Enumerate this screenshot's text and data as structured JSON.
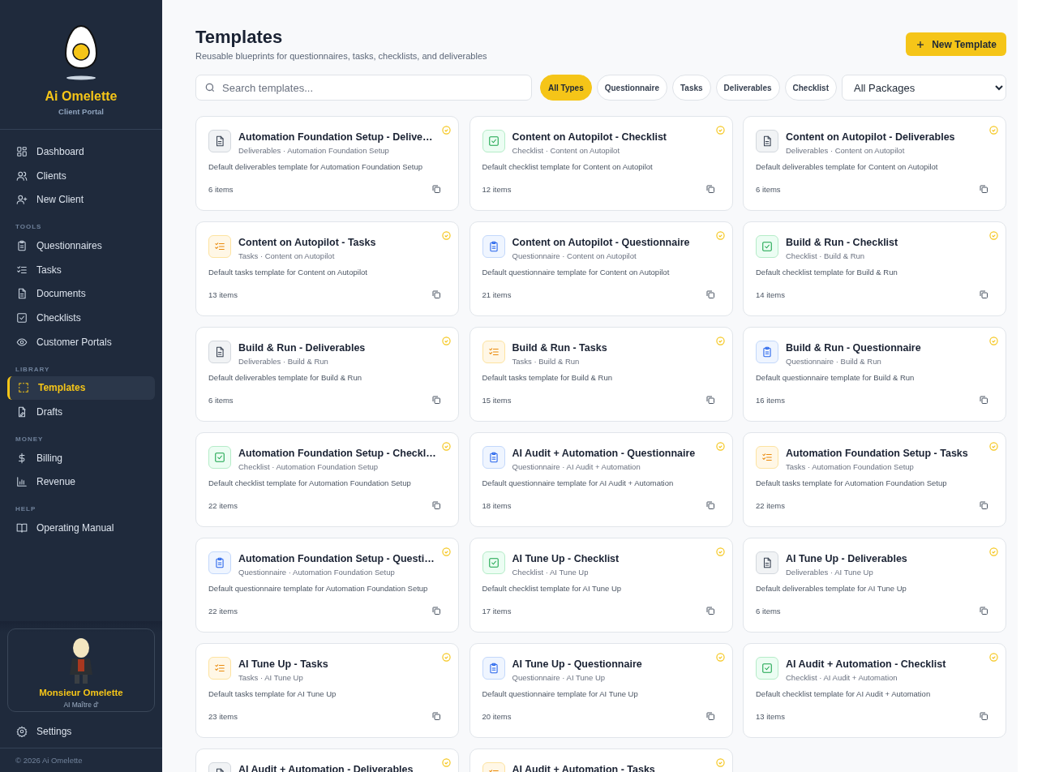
{
  "sidebar": {
    "brand": {
      "name": "Ai Omelette",
      "subtitle": "Client Portal"
    },
    "sections": [
      {
        "items": [
          {
            "label": "Dashboard",
            "selected": false
          },
          {
            "label": "Clients",
            "selected": false
          },
          {
            "label": "New Client",
            "selected": false
          }
        ]
      },
      {
        "label": "TOOLS",
        "items": [
          {
            "label": "Questionnaires",
            "selected": false
          },
          {
            "label": "Tasks",
            "selected": false
          },
          {
            "label": "Documents",
            "selected": false
          },
          {
            "label": "Checklists",
            "selected": false
          },
          {
            "label": "Customer Portals",
            "selected": false
          }
        ]
      },
      {
        "label": "LIBRARY",
        "items": [
          {
            "label": "Templates",
            "selected": true
          },
          {
            "label": "Drafts",
            "selected": false
          }
        ]
      },
      {
        "label": "MONEY",
        "items": [
          {
            "label": "Billing",
            "selected": false
          },
          {
            "label": "Revenue",
            "selected": false
          }
        ]
      },
      {
        "label": "HELP",
        "items": [
          {
            "label": "Operating Manual",
            "selected": false
          }
        ]
      }
    ],
    "profile": {
      "name": "Monsieur Omelette",
      "role": "AI Maître d'"
    },
    "settings": {
      "label": "Settings"
    },
    "footer": "© 2026 Ai Omelette"
  },
  "header": {
    "title": "Templates",
    "subtitle": "Reusable blueprints for questionnaires, tasks, checklists, and deliverables",
    "new_button": "New Template"
  },
  "filters": {
    "search_placeholder": "Search templates...",
    "chips": [
      {
        "label": "All Types",
        "selected": true
      },
      {
        "label": "Questionnaire",
        "selected": false
      },
      {
        "label": "Tasks",
        "selected": false
      },
      {
        "label": "Deliverables",
        "selected": false
      },
      {
        "label": "Checklist",
        "selected": false
      }
    ],
    "package_select": "All Packages"
  },
  "templates": [
    {
      "kind": "deliverables",
      "title": "Automation Foundation Setup - Delive…",
      "subtitle": "Deliverables · Automation Foundation Setup",
      "description": "Default deliverables template for Automation Foundation Setup",
      "count": "6 items"
    },
    {
      "kind": "checklist",
      "title": "Content on Autopilot - Checklist",
      "subtitle": "Checklist · Content on Autopilot",
      "description": "Default checklist template for Content on Autopilot",
      "count": "12 items"
    },
    {
      "kind": "deliverables",
      "title": "Content on Autopilot - Deliverables",
      "subtitle": "Deliverables · Content on Autopilot",
      "description": "Default deliverables template for Content on Autopilot",
      "count": "6 items"
    },
    {
      "kind": "tasks",
      "title": "Content on Autopilot - Tasks",
      "subtitle": "Tasks · Content on Autopilot",
      "description": "Default tasks template for Content on Autopilot",
      "count": "13 items"
    },
    {
      "kind": "questionnaire",
      "title": "Content on Autopilot - Questionnaire",
      "subtitle": "Questionnaire · Content on Autopilot",
      "description": "Default questionnaire template for Content on Autopilot",
      "count": "21 items"
    },
    {
      "kind": "checklist",
      "title": "Build & Run - Checklist",
      "subtitle": "Checklist · Build & Run",
      "description": "Default checklist template for Build & Run",
      "count": "14 items"
    },
    {
      "kind": "deliverables",
      "title": "Build & Run - Deliverables",
      "subtitle": "Deliverables · Build & Run",
      "description": "Default deliverables template for Build & Run",
      "count": "6 items"
    },
    {
      "kind": "tasks",
      "title": "Build & Run - Tasks",
      "subtitle": "Tasks · Build & Run",
      "description": "Default tasks template for Build & Run",
      "count": "15 items"
    },
    {
      "kind": "questionnaire",
      "title": "Build & Run - Questionnaire",
      "subtitle": "Questionnaire · Build & Run",
      "description": "Default questionnaire template for Build & Run",
      "count": "16 items"
    },
    {
      "kind": "checklist",
      "title": "Automation Foundation Setup - Checkl…",
      "subtitle": "Checklist · Automation Foundation Setup",
      "description": "Default checklist template for Automation Foundation Setup",
      "count": "22 items"
    },
    {
      "kind": "questionnaire",
      "title": "AI Audit + Automation - Questionnaire",
      "subtitle": "Questionnaire · AI Audit + Automation",
      "description": "Default questionnaire template for AI Audit + Automation",
      "count": "18 items"
    },
    {
      "kind": "tasks",
      "title": "Automation Foundation Setup - Tasks",
      "subtitle": "Tasks · Automation Foundation Setup",
      "description": "Default tasks template for Automation Foundation Setup",
      "count": "22 items"
    },
    {
      "kind": "questionnaire",
      "title": "Automation Foundation Setup - Questi…",
      "subtitle": "Questionnaire · Automation Foundation Setup",
      "description": "Default questionnaire template for Automation Foundation Setup",
      "count": "22 items"
    },
    {
      "kind": "checklist",
      "title": "AI Tune Up - Checklist",
      "subtitle": "Checklist · AI Tune Up",
      "description": "Default checklist template for AI Tune Up",
      "count": "17 items"
    },
    {
      "kind": "deliverables",
      "title": "AI Tune Up - Deliverables",
      "subtitle": "Deliverables · AI Tune Up",
      "description": "Default deliverables template for AI Tune Up",
      "count": "6 items"
    },
    {
      "kind": "tasks",
      "title": "AI Tune Up - Tasks",
      "subtitle": "Tasks · AI Tune Up",
      "description": "Default tasks template for AI Tune Up",
      "count": "23 items"
    },
    {
      "kind": "questionnaire",
      "title": "AI Tune Up - Questionnaire",
      "subtitle": "Questionnaire · AI Tune Up",
      "description": "Default questionnaire template for AI Tune Up",
      "count": "20 items"
    },
    {
      "kind": "checklist",
      "title": "AI Audit + Automation - Checklist",
      "subtitle": "Checklist · AI Audit + Automation",
      "description": "Default checklist template for AI Audit + Automation",
      "count": "13 items"
    },
    {
      "kind": "deliverables",
      "title": "AI Audit + Automation - Deliverables"
    },
    {
      "kind": "tasks",
      "title": "AI Audit + Automation - Tasks"
    }
  ]
}
